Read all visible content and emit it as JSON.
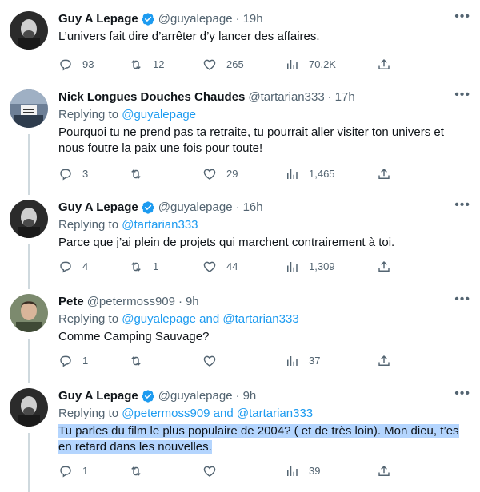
{
  "tweets": [
    {
      "name": "Guy A Lepage",
      "verified": true,
      "handle": "@guyalepage",
      "dot": "·",
      "time": "19h",
      "reply_prefix": "",
      "reply_to": "",
      "text": "L’univers fait dire d’arrêter d’y lancer des affaires.",
      "replies": "93",
      "retweets": "12",
      "likes": "265",
      "views": "70.2K",
      "highlighted": false
    },
    {
      "name": "Nick Longues Douches Chaudes",
      "verified": false,
      "handle": "@tartarian333",
      "dot": "·",
      "time": "17h",
      "reply_prefix": "Replying to ",
      "reply_to": "@guyalepage",
      "text": "Pourquoi tu ne prend pas ta retraite, tu pourrait aller visiter ton univers et nous foutre la paix une fois pour toute!",
      "replies": "3",
      "retweets": "",
      "likes": "29",
      "views": "1,465",
      "highlighted": false
    },
    {
      "name": "Guy A Lepage",
      "verified": true,
      "handle": "@guyalepage",
      "dot": "·",
      "time": "16h",
      "reply_prefix": "Replying to ",
      "reply_to": "@tartarian333",
      "text": "Parce que j’ai plein de projets qui marchent contrairement à toi.",
      "replies": "4",
      "retweets": "1",
      "likes": "44",
      "views": "1,309",
      "highlighted": false
    },
    {
      "name": "Pete",
      "verified": false,
      "handle": "@petermoss909",
      "dot": "·",
      "time": "9h",
      "reply_prefix": "Replying to ",
      "reply_to": "@guyalepage and @tartarian333",
      "text": "Comme Camping Sauvage?",
      "replies": "1",
      "retweets": "",
      "likes": "",
      "views": "37",
      "highlighted": false
    },
    {
      "name": "Guy A Lepage",
      "verified": true,
      "handle": "@guyalepage",
      "dot": "·",
      "time": "9h",
      "reply_prefix": "Replying to ",
      "reply_to": "@petermoss909 and @tartarian333",
      "text_line1": "Tu parles du film le plus populaire de 2004? ( et de très loin). Mon dieu, t’es",
      "text_line2": "en retard dans les nouvelles.",
      "replies": "1",
      "retweets": "",
      "likes": "",
      "views": "39",
      "highlighted": true
    }
  ],
  "icons": {
    "reply": "reply-icon",
    "retweet": "retweet-icon",
    "like": "heart-icon",
    "views": "views-chart-icon",
    "share": "share-icon",
    "more": "more-icon",
    "verified": "verified-badge-icon"
  },
  "colors": {
    "accent": "#1d9bf0",
    "secondary_text": "#536471",
    "text": "#0f1419",
    "thread_line": "#cfd9de",
    "highlight": "#b4d5fe"
  }
}
